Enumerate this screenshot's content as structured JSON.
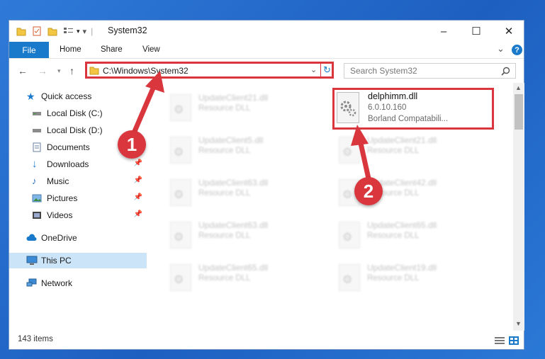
{
  "window": {
    "title": "System32",
    "controls": {
      "minimize": "–",
      "maximize": "☐",
      "close": "✕"
    }
  },
  "ribbon": {
    "tabs": [
      "File",
      "Home",
      "Share",
      "View"
    ],
    "help": "?",
    "collapse": "⌄"
  },
  "navigation": {
    "address": "C:\\Windows\\System32",
    "search_placeholder": "Search System32"
  },
  "sidebar": {
    "items": [
      {
        "label": "Quick access",
        "icon": "star-icon"
      },
      {
        "label": "Local Disk (C:)",
        "icon": "drive-icon"
      },
      {
        "label": "Local Disk (D:)",
        "icon": "drive-icon"
      },
      {
        "label": "Documents",
        "icon": "documents-icon",
        "pinned": true
      },
      {
        "label": "Downloads",
        "icon": "downloads-icon",
        "pinned": true
      },
      {
        "label": "Music",
        "icon": "music-icon",
        "pinned": true
      },
      {
        "label": "Pictures",
        "icon": "pictures-icon",
        "pinned": true
      },
      {
        "label": "Videos",
        "icon": "videos-icon",
        "pinned": true
      },
      {
        "label": "OneDrive",
        "icon": "cloud-icon"
      },
      {
        "label": "This PC",
        "icon": "computer-icon",
        "selected": true
      },
      {
        "label": "Network",
        "icon": "network-icon"
      }
    ]
  },
  "files": [
    {
      "name": "UpdateClient21.dll",
      "type": "Resource DLL"
    },
    {
      "name": "delphimm.dll",
      "version": "6.0.10.160",
      "type": "Borland Compatabili...",
      "highlighted": true
    },
    {
      "name": "UpdateClient5.dll",
      "type": "Resource DLL"
    },
    {
      "name": "UpdateClient21.dll",
      "type": "Resource DLL"
    },
    {
      "name": "UpdateClient63.dll",
      "type": "Resource DLL"
    },
    {
      "name": "UpdateClient42.dll",
      "type": "Resource DLL"
    },
    {
      "name": "UpdateClient63.dll",
      "type": "Resource DLL"
    },
    {
      "name": "UpdateClient65.dll",
      "type": "Resource DLL"
    },
    {
      "name": "UpdateClient65.dll",
      "type": "Resource DLL"
    },
    {
      "name": "UpdateClient19.dll",
      "type": "Resource DLL"
    }
  ],
  "status": {
    "item_count": "143 items"
  },
  "annotations": {
    "step1": "1",
    "step2": "2"
  },
  "colors": {
    "accent": "#1979ca",
    "highlight": "#d9363e",
    "selected": "#cce4f7"
  }
}
